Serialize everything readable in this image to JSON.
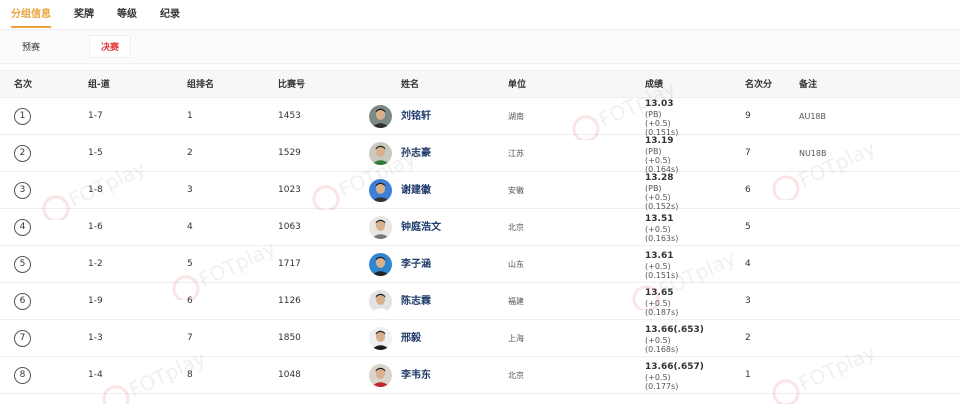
{
  "tabs": [
    {
      "label": "分组信息",
      "active": true
    },
    {
      "label": "奖牌",
      "active": false
    },
    {
      "label": "等级",
      "active": false
    },
    {
      "label": "纪录",
      "active": false
    }
  ],
  "subtabs": [
    {
      "label": "预赛",
      "active": false
    },
    {
      "label": "决赛",
      "active": true
    }
  ],
  "headers": {
    "rank": "名次",
    "group_lane": "组-道",
    "group_rank": "组排名",
    "bib": "比赛号",
    "name": "姓名",
    "unit": "单位",
    "result": "成绩",
    "points": "名次分",
    "note": "备注"
  },
  "rows": [
    {
      "rank": "1",
      "group_lane": "1-7",
      "group_rank": "1",
      "bib": "1453",
      "name": "刘铭轩",
      "unit": "湖南",
      "score": "13.03",
      "pb": "(PB)",
      "wind": "(+0.5)",
      "reaction": "(0.151s)",
      "points": "9",
      "note": "AU18B",
      "avatar_bg": "#7b8a86",
      "avatar_shirt": "#2e2e2e"
    },
    {
      "rank": "2",
      "group_lane": "1-5",
      "group_rank": "2",
      "bib": "1529",
      "name": "孙志豪",
      "unit": "江苏",
      "score": "13.19",
      "pb": "(PB)",
      "wind": "(+0.5)",
      "reaction": "(0.164s)",
      "points": "7",
      "note": "NU18B",
      "avatar_bg": "#c9c9c2",
      "avatar_shirt": "#2f7a3a"
    },
    {
      "rank": "3",
      "group_lane": "1-8",
      "group_rank": "3",
      "bib": "1023",
      "name": "谢建徽",
      "unit": "安徽",
      "score": "13.28",
      "pb": "(PB)",
      "wind": "(+0.5)",
      "reaction": "(0.152s)",
      "points": "6",
      "note": "",
      "avatar_bg": "#3b7fd6",
      "avatar_shirt": "#333333"
    },
    {
      "rank": "4",
      "group_lane": "1-6",
      "group_rank": "4",
      "bib": "1063",
      "name": "钟庭浩文",
      "unit": "北京",
      "score": "13.51",
      "pb": "",
      "wind": "(+0.5)",
      "reaction": "(0.163s)",
      "points": "5",
      "note": "",
      "avatar_bg": "#e8e6e0",
      "avatar_shirt": "#777777"
    },
    {
      "rank": "5",
      "group_lane": "1-2",
      "group_rank": "5",
      "bib": "1717",
      "name": "李子涵",
      "unit": "山东",
      "score": "13.61",
      "pb": "",
      "wind": "(+0.5)",
      "reaction": "(0.151s)",
      "points": "4",
      "note": "",
      "avatar_bg": "#2f86d0",
      "avatar_shirt": "#222222"
    },
    {
      "rank": "6",
      "group_lane": "1-9",
      "group_rank": "6",
      "bib": "1126",
      "name": "陈志霖",
      "unit": "福建",
      "score": "13.65",
      "pb": "",
      "wind": "(+0.5)",
      "reaction": "(0.187s)",
      "points": "3",
      "note": "",
      "avatar_bg": "#e2e2e2",
      "avatar_shirt": "#ffffff"
    },
    {
      "rank": "7",
      "group_lane": "1-3",
      "group_rank": "7",
      "bib": "1850",
      "name": "邢毅",
      "unit": "上海",
      "score": "13.66(.653)",
      "pb": "",
      "wind": "(+0.5)",
      "reaction": "(0.168s)",
      "points": "2",
      "note": "",
      "avatar_bg": "#f0f0f0",
      "avatar_shirt": "#1b1b1b"
    },
    {
      "rank": "8",
      "group_lane": "1-4",
      "group_rank": "8",
      "bib": "1048",
      "name": "李韦东",
      "unit": "北京",
      "score": "13.66(.657)",
      "pb": "",
      "wind": "(+0.5)",
      "reaction": "(0.177s)",
      "points": "1",
      "note": "",
      "avatar_bg": "#d9d4cc",
      "avatar_shirt": "#c0262b"
    }
  ]
}
